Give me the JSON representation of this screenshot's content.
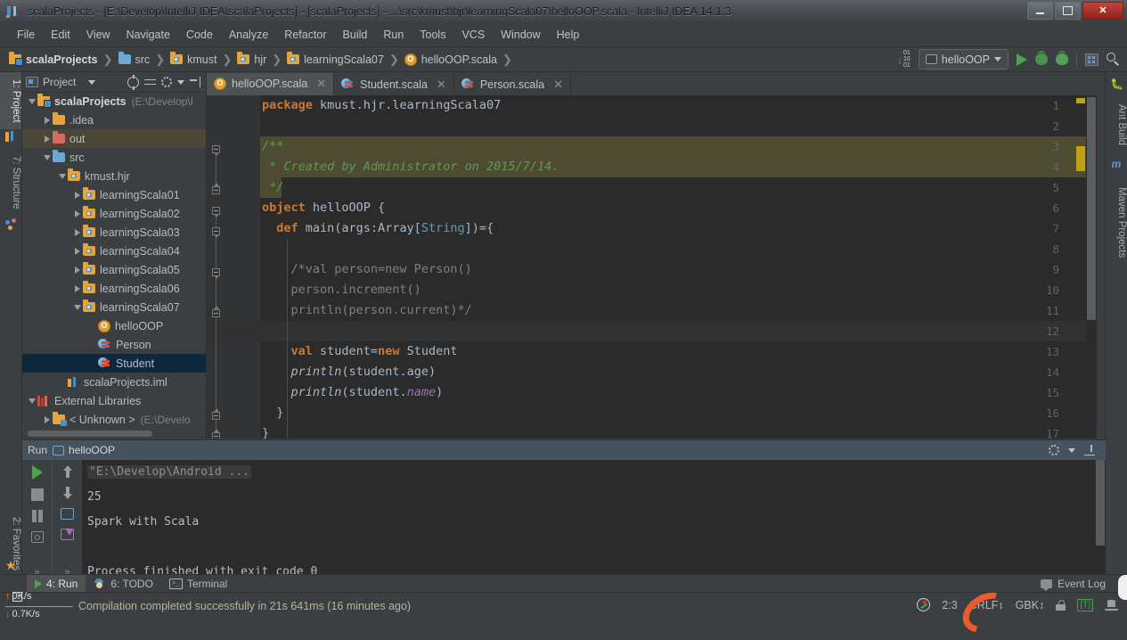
{
  "window": {
    "title": "scalaProjects - [E:\\Develop\\IntelliJ IDEA\\scalaProjects] - [scalaProjects] - ...\\src\\kmust\\hjr\\learningScala07\\helloOOP.scala - IntelliJ IDEA 14.1.3",
    "minimize": "–",
    "maximize": "❐",
    "close": "✕"
  },
  "menu": [
    "File",
    "Edit",
    "View",
    "Navigate",
    "Code",
    "Analyze",
    "Refactor",
    "Build",
    "Run",
    "Tools",
    "VCS",
    "Window",
    "Help"
  ],
  "breadcrumb": [
    {
      "label": "scalaProjects",
      "icon": "project-folder-icon"
    },
    {
      "label": "src",
      "icon": "source-folder-icon"
    },
    {
      "label": "kmust",
      "icon": "package-folder-icon"
    },
    {
      "label": "hjr",
      "icon": "package-folder-icon"
    },
    {
      "label": "learningScala07",
      "icon": "package-folder-icon"
    },
    {
      "label": "helloOOP.scala",
      "icon": "scala-object-icon"
    }
  ],
  "toolbar": {
    "run_config": "helloOOP",
    "compare_counts": [
      "01",
      "10",
      "01"
    ],
    "run_title": "Run",
    "debug_title": "Debug",
    "coverage_title": "Run with Coverage",
    "structure_title": "Structure",
    "search_title": "Search Everywhere"
  },
  "left_tabs": [
    {
      "label": "1: Project",
      "active": true
    },
    {
      "label": "7: Structure",
      "active": false
    },
    {
      "label": "2: Favorites",
      "active": false
    }
  ],
  "right_tabs": [
    {
      "label": "Ant Build"
    },
    {
      "label": "Maven Projects"
    }
  ],
  "project_panel": {
    "title": "Project",
    "tree": [
      {
        "depth": 0,
        "twisty": "open",
        "icon": "project-icon",
        "label": "scalaProjects",
        "sub": "(E:\\Develop\\I",
        "bold": true,
        "state": "normal"
      },
      {
        "depth": 1,
        "twisty": "closed",
        "icon": "folder-icon",
        "label": ".idea",
        "sub": "",
        "bold": false,
        "state": "normal"
      },
      {
        "depth": 1,
        "twisty": "closed",
        "icon": "folder-red",
        "label": "out",
        "sub": "",
        "bold": false,
        "state": "hover"
      },
      {
        "depth": 1,
        "twisty": "open",
        "icon": "folder-blue",
        "label": "src",
        "sub": "",
        "bold": false,
        "state": "normal"
      },
      {
        "depth": 2,
        "twisty": "open",
        "icon": "package-icon",
        "label": "kmust.hjr",
        "sub": "",
        "bold": false,
        "state": "normal"
      },
      {
        "depth": 3,
        "twisty": "closed",
        "icon": "package-icon",
        "label": "learningScala01",
        "sub": "",
        "bold": false,
        "state": "normal"
      },
      {
        "depth": 3,
        "twisty": "closed",
        "icon": "package-icon",
        "label": "learningScala02",
        "sub": "",
        "bold": false,
        "state": "normal"
      },
      {
        "depth": 3,
        "twisty": "closed",
        "icon": "package-icon",
        "label": "learningScala03",
        "sub": "",
        "bold": false,
        "state": "normal"
      },
      {
        "depth": 3,
        "twisty": "closed",
        "icon": "package-icon",
        "label": "learningScala04",
        "sub": "",
        "bold": false,
        "state": "normal"
      },
      {
        "depth": 3,
        "twisty": "closed",
        "icon": "package-icon",
        "label": "learningScala05",
        "sub": "",
        "bold": false,
        "state": "normal"
      },
      {
        "depth": 3,
        "twisty": "closed",
        "icon": "package-icon",
        "label": "learningScala06",
        "sub": "",
        "bold": false,
        "state": "normal"
      },
      {
        "depth": 3,
        "twisty": "open",
        "icon": "package-icon",
        "label": "learningScala07",
        "sub": "",
        "bold": false,
        "state": "normal"
      },
      {
        "depth": 4,
        "twisty": "none",
        "icon": "scala-object-icon",
        "label": "helloOOP",
        "sub": "",
        "bold": false,
        "state": "normal"
      },
      {
        "depth": 4,
        "twisty": "none",
        "icon": "scala-class-icon",
        "label": "Person",
        "sub": "",
        "bold": false,
        "state": "normal"
      },
      {
        "depth": 4,
        "twisty": "none",
        "icon": "scala-class-icon",
        "label": "Student",
        "sub": "",
        "bold": false,
        "state": "selected"
      },
      {
        "depth": 2,
        "twisty": "none",
        "icon": "iml-icon",
        "label": "scalaProjects.iml",
        "sub": "",
        "bold": false,
        "state": "normal"
      },
      {
        "depth": 0,
        "twisty": "open",
        "icon": "library-icon",
        "label": "External Libraries",
        "sub": "",
        "bold": false,
        "state": "normal"
      },
      {
        "depth": 1,
        "twisty": "closed",
        "icon": "lib-folder-icon",
        "label": "< Unknown >",
        "sub": "(E:\\Develo",
        "bold": false,
        "state": "normal"
      }
    ]
  },
  "editor_tabs": [
    {
      "label": "helloOOP.scala",
      "icon": "scala-object-icon",
      "active": true
    },
    {
      "label": "Student.scala",
      "icon": "scala-class-icon",
      "active": false
    },
    {
      "label": "Person.scala",
      "icon": "scala-class-icon",
      "active": false
    }
  ],
  "editor": {
    "line_numbers": [
      "1",
      "2",
      "3",
      "4",
      "5",
      "6",
      "7",
      "8",
      "9",
      "10",
      "11",
      "12",
      "13",
      "14",
      "15",
      "16",
      "17"
    ],
    "lines": [
      {
        "n": 1,
        "html": "<span class=\"kw\">package</span> kmust.hjr.learningScala07"
      },
      {
        "n": 2,
        "html": ""
      },
      {
        "n": 3,
        "html": "<span class=\"cm\">/**</span>"
      },
      {
        "n": 4,
        "html": "<span class=\"cm\"> * Created by Administrator on 2015/7/14.</span>"
      },
      {
        "n": 5,
        "html": "<span class=\"cm\"> */</span>"
      },
      {
        "n": 6,
        "html": "<span class=\"kw\">object</span> helloOOP {"
      },
      {
        "n": 7,
        "html": "  <span class=\"kw\">def</span> main(args:Array[<span class=\"ty\">String</span>])={"
      },
      {
        "n": 8,
        "html": ""
      },
      {
        "n": 9,
        "html": "    <span class=\"cm2\">/*val person=new Person()</span>"
      },
      {
        "n": 10,
        "html": "    <span class=\"cm2\">person.increment()</span>"
      },
      {
        "n": 11,
        "html": "    <span class=\"cm2\">println(person.current)*/</span>"
      },
      {
        "n": 12,
        "html": ""
      },
      {
        "n": 13,
        "html": "    <span class=\"kw\">val</span> student=<span class=\"kw\">new</span> Student"
      },
      {
        "n": 14,
        "html": "    <span class=\"fn\">println</span>(student.age)"
      },
      {
        "n": 15,
        "html": "    <span class=\"fn\">println</span>(student.<span class=\"fld\">name</span>)"
      },
      {
        "n": 16,
        "html": "  }"
      },
      {
        "n": 17,
        "html": "}"
      }
    ],
    "plain": [
      "package kmust.hjr.learningScala07",
      "",
      "/**",
      " * Created by Administrator on 2015/7/14.",
      " */",
      "object helloOOP {",
      "  def main(args:Array[String])={",
      "",
      "    /*val person=new Person()",
      "    person.increment()",
      "    println(person.current)*/",
      "",
      "    val student=new Student",
      "    println(student.age)",
      "    println(student.name)",
      "  }",
      "}"
    ]
  },
  "run_panel": {
    "title": "Run",
    "config_name": "helloOOP",
    "console": [
      {
        "text": "\"E:\\Develop\\Android ...",
        "muted": true
      },
      {
        "text": "25",
        "muted": false
      },
      {
        "text": "Spark with Scala",
        "muted": false
      },
      {
        "text": "Process finished with exit code 0",
        "muted": false
      }
    ]
  },
  "bottom_bar": {
    "windows": [
      {
        "label": "4: Run",
        "icon": "run-icon",
        "active": true
      },
      {
        "label": "6: TODO",
        "icon": "todo-icon",
        "active": false
      },
      {
        "label": "Terminal",
        "icon": "terminal-icon",
        "active": false
      }
    ],
    "event_log": "Event Log"
  },
  "status_bar": {
    "message": "Compilation completed successfully in 21s 641ms (16 minutes ago)",
    "caret": "2:3",
    "line_separator": "CRLF",
    "encoding": "GBK",
    "lock": "unlocked",
    "t_badge": "[T]",
    "hat": "hector-icon"
  },
  "net_widget": {
    "upload": "0K/s",
    "download": "0.7K/s"
  },
  "colors": {
    "accent_orange": "#cc7832",
    "comment_green": "#629755",
    "string_blue": "#5f9fbf",
    "field_purple": "#9876aa",
    "editor_bg": "#2b2b2b",
    "panel_bg": "#3c3f41",
    "selection_blue": "#0d293e",
    "doc_highlight": "#4e4b33",
    "run_header": "#47525f",
    "status_text": "#b9b1a2"
  }
}
